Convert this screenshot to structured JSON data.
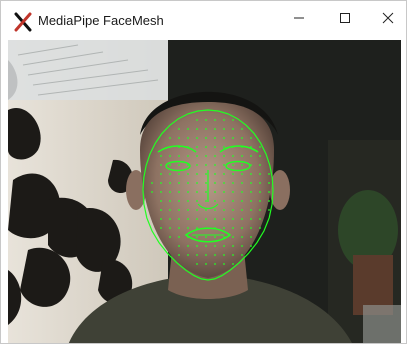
{
  "window": {
    "title": "MediaPipe FaceMesh",
    "app_icon": "x-logo-icon",
    "controls": {
      "minimize_icon": "minimize-icon",
      "maximize_icon": "maximize-icon",
      "close_icon": "close-icon"
    }
  },
  "viewport": {
    "content": "webcam-feed",
    "overlay": "face-mesh",
    "mesh_color": "#22ff22"
  }
}
